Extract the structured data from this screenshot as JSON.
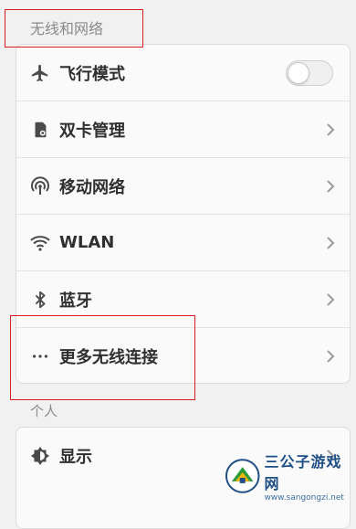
{
  "sections": [
    {
      "title": "无线和网络",
      "items": [
        {
          "label": "飞行模式",
          "icon": "airplane-icon",
          "control": "toggle",
          "toggle_on": false
        },
        {
          "label": "双卡管理",
          "icon": "sim-card-icon",
          "control": "chevron"
        },
        {
          "label": "移动网络",
          "icon": "mobile-signal-icon",
          "control": "chevron"
        },
        {
          "label": "WLAN",
          "icon": "wifi-icon",
          "control": "chevron"
        },
        {
          "label": "蓝牙",
          "icon": "bluetooth-icon",
          "control": "chevron"
        },
        {
          "label": "更多无线连接",
          "icon": "more-dots-icon",
          "control": "chevron"
        }
      ]
    },
    {
      "title": "个人",
      "items": [
        {
          "label": "显示",
          "icon": "brightness-icon",
          "control": "chevron"
        }
      ]
    }
  ],
  "watermark": {
    "name": "三公子游戏网",
    "url": "www.sangongzi.net"
  },
  "colors": {
    "highlight_box": "#d81e1e",
    "background": "#f1f1f1",
    "card": "#fafafa"
  }
}
